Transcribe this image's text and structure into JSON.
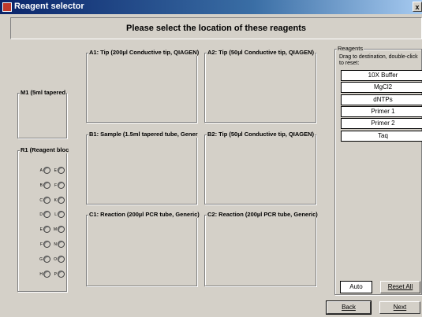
{
  "window": {
    "title": "Reagent selector",
    "close_label": "x"
  },
  "header": {
    "text": "Please select the location of these reagents"
  },
  "left": {
    "m1_label": "M1 (5ml tapered",
    "r1_label": "R1 (Reagent bloc",
    "wells": [
      [
        "A",
        "E"
      ],
      [
        "B",
        "F"
      ],
      [
        "C",
        "K"
      ],
      [
        "D",
        "L"
      ],
      [
        "E",
        "M"
      ],
      [
        "F",
        "N"
      ],
      [
        "G",
        "O"
      ],
      [
        "H",
        "P"
      ]
    ]
  },
  "slots": {
    "a1": "A1: Tip (200µl Conductive tip, QIAGEN)",
    "a2": "A2: Tip (50µl Conductive tip, QIAGEN)",
    "b1": "B1: Sample (1.5ml tapered tube, Gener",
    "b2": "B2: Tip (50µl Conductive tip, QIAGEN)",
    "c1": "C1: Reaction (200µl PCR tube, Generic)",
    "c2": "C2: Reaction (200µl PCR tube, Generic)"
  },
  "reagents": {
    "title": "Reagents",
    "instructions": "Drag to destination, double-click to reset:",
    "items": [
      "10X Buffer",
      "MgCl2",
      "dNTPs",
      "Primer 1",
      "Primer 2",
      "Taq"
    ]
  },
  "buttons": {
    "auto": "Auto",
    "reset_all": "Reset All",
    "back": "Back",
    "next": "Next"
  }
}
